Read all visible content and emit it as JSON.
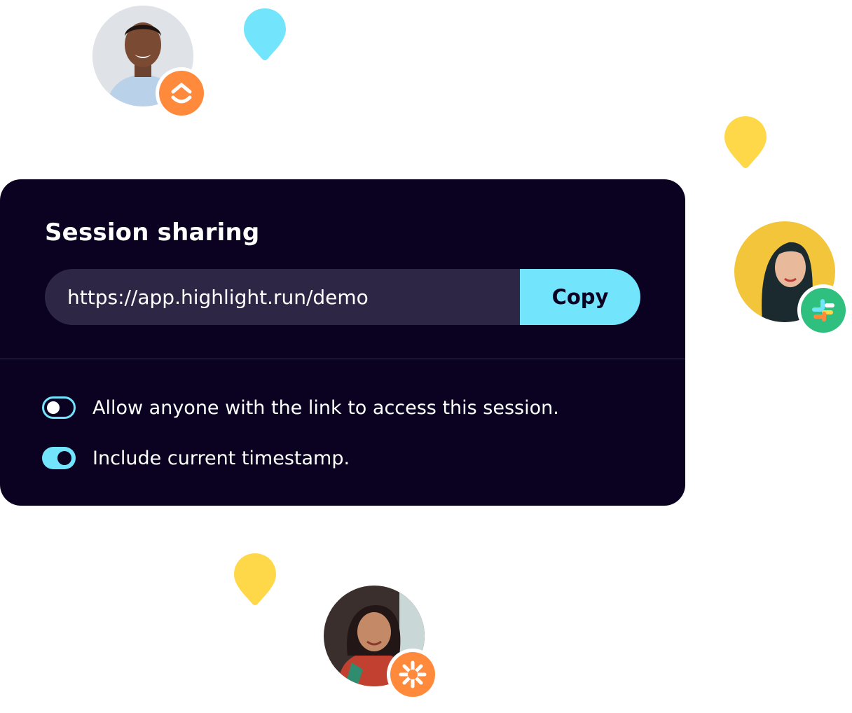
{
  "session": {
    "title": "Session sharing",
    "url": "https://app.highlight.run/demo",
    "copy_label": "Copy",
    "options": [
      {
        "label": "Allow anyone with the link to access this session.",
        "enabled": false
      },
      {
        "label": "Include current timestamp.",
        "enabled": true
      }
    ]
  },
  "decor": {
    "avatars": [
      {
        "name": "avatar-man",
        "badge": "clickup-icon"
      },
      {
        "name": "avatar-woman-yellow",
        "badge": "slack-icon"
      },
      {
        "name": "avatar-woman-bottom",
        "badge": "zapier-icon"
      }
    ],
    "pins": [
      "location-pin-icon"
    ]
  },
  "colors": {
    "panel_bg": "#0b0222",
    "field_bg": "#2d2745",
    "accent": "#72e4fc",
    "pin_cyan": "#72e4fc",
    "pin_yellow": "#ffd84a",
    "badge_orange": "#ff8a3c",
    "badge_green": "#2fbf7f"
  }
}
